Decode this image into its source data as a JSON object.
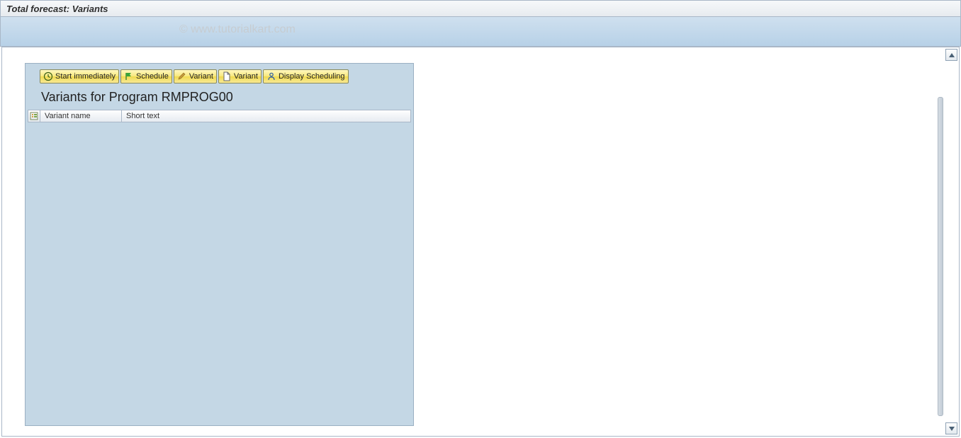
{
  "header": {
    "title": "Total forecast: Variants"
  },
  "watermark": "© www.tutorialkart.com",
  "toolbar": {
    "start_immediately": "Start immediately",
    "schedule": "Schedule",
    "variant_edit": "Variant",
    "variant_create": "Variant",
    "display_scheduling": "Display Scheduling"
  },
  "panel": {
    "title": "Variants for Program RMPROG00"
  },
  "table": {
    "columns": {
      "variant_name": "Variant name",
      "short_text": "Short text"
    },
    "rows": []
  }
}
